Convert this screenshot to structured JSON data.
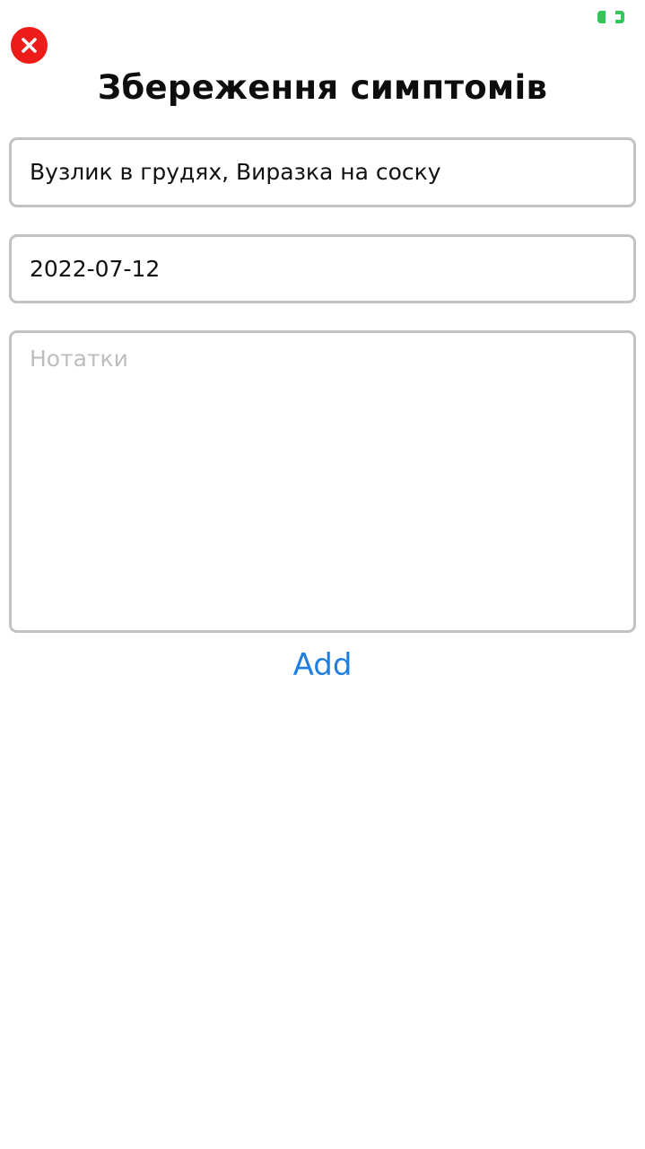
{
  "colors": {
    "accent": "#1f7fe0",
    "close_button": "#ee1b1b",
    "status_indicator": "#33c75a",
    "field_border": "#c2c2c2",
    "placeholder": "#bdbdbd"
  },
  "header": {
    "close_icon": "close-icon",
    "title": "Збереження симптомів"
  },
  "status_indicator": {
    "icon": "battery-icon"
  },
  "form": {
    "symptoms_value": "Вузлик в грудях, Виразка на соску",
    "date_value": "2022-07-12",
    "notes_value": "",
    "notes_placeholder": "Нотатки",
    "add_label": "Add"
  }
}
